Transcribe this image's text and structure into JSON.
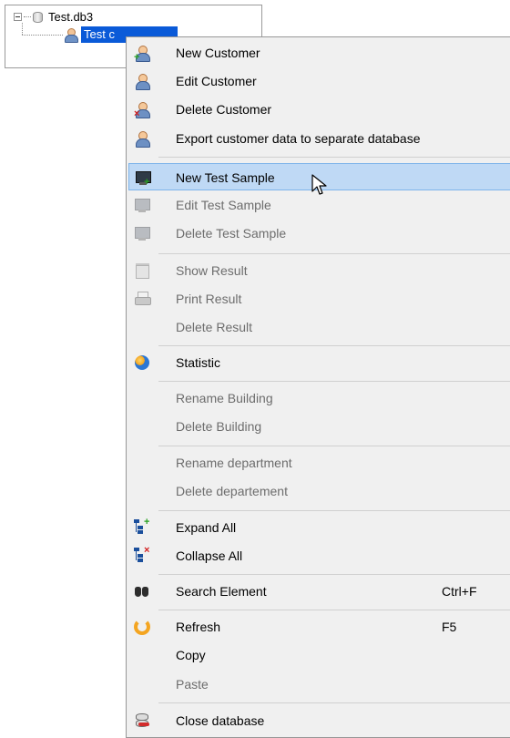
{
  "tree": {
    "root_label": "Test.db3",
    "child_label": "Test c"
  },
  "menu": {
    "items": [
      {
        "label": "New Customer",
        "icon": "person-add-icon",
        "enabled": true
      },
      {
        "label": "Edit Customer",
        "icon": "person-icon",
        "enabled": true
      },
      {
        "label": "Delete Customer",
        "icon": "person-delete-icon",
        "enabled": true
      },
      {
        "label": "Export customer data to separate database",
        "icon": "export-users-icon",
        "enabled": true
      },
      {
        "label": "New Test Sample",
        "icon": "monitor-add-icon",
        "enabled": true,
        "highlighted": true
      },
      {
        "label": "Edit Test Sample",
        "icon": "monitor-edit-icon",
        "enabled": false
      },
      {
        "label": "Delete Test Sample",
        "icon": "monitor-delete-icon",
        "enabled": false
      },
      {
        "label": "Show Result",
        "icon": "calendar-icon",
        "enabled": false
      },
      {
        "label": "Print Result",
        "icon": "printer-icon",
        "enabled": false
      },
      {
        "label": "Delete Result",
        "icon": "",
        "enabled": false
      },
      {
        "label": "Statistic",
        "icon": "statistic-icon",
        "enabled": true
      },
      {
        "label": "Rename Building",
        "icon": "",
        "enabled": false
      },
      {
        "label": "Delete Building",
        "icon": "",
        "enabled": false
      },
      {
        "label": "Rename department",
        "icon": "",
        "enabled": false
      },
      {
        "label": "Delete departement",
        "icon": "",
        "enabled": false
      },
      {
        "label": "Expand All",
        "icon": "tree-expand-icon",
        "enabled": true
      },
      {
        "label": "Collapse All",
        "icon": "tree-collapse-icon",
        "enabled": true
      },
      {
        "label": "Search Element",
        "icon": "binoculars-icon",
        "enabled": true,
        "shortcut": "Ctrl+F"
      },
      {
        "label": "Refresh",
        "icon": "refresh-icon",
        "enabled": true,
        "shortcut": "F5"
      },
      {
        "label": "Copy",
        "icon": "",
        "enabled": true
      },
      {
        "label": "Paste",
        "icon": "",
        "enabled": false
      },
      {
        "label": "Close database",
        "icon": "close-database-icon",
        "enabled": true
      }
    ]
  },
  "colors": {
    "selection": "#0a5ad8",
    "hover_bg": "#bfd9f5",
    "hover_border": "#7eb4ea",
    "disabled_text": "#6d6d6d"
  }
}
